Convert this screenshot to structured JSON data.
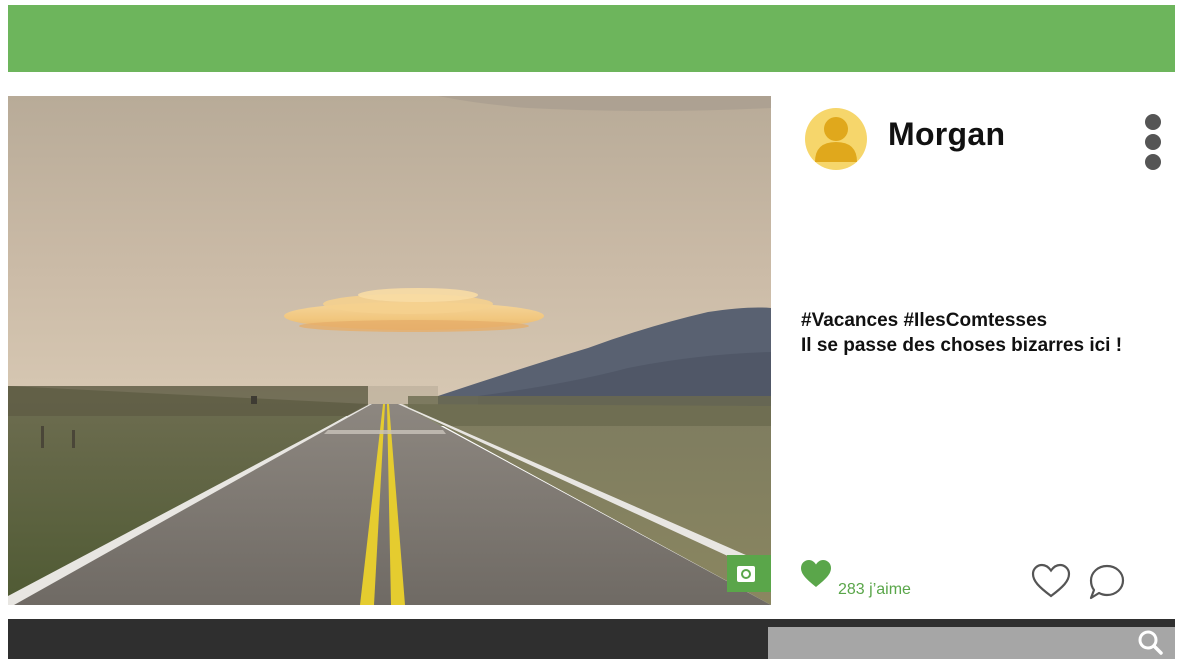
{
  "colors": {
    "accent": "#6db55c",
    "accent_dark": "#5aa64a",
    "footer": "#2f2f2f",
    "search_bg": "#a6a6a6",
    "avatar_bg": "#f6d66b",
    "avatar_figure": "#e0a81c",
    "icon_grey": "#555555"
  },
  "post": {
    "author": "Morgan",
    "caption_line1": "#Vacances #IlesComtesses",
    "caption_line2": "Il se passe des choses bizarres ici !",
    "likes_label": "283 j’aime",
    "photo_badge_icon": "camera-icon"
  },
  "icons": {
    "avatar": "user-avatar-icon",
    "more": "more-vertical-icon",
    "liked": "heart-filled-icon",
    "like": "heart-outline-icon",
    "comment": "comment-bubble-icon",
    "search": "search-icon"
  },
  "search": {
    "value": "",
    "placeholder": ""
  }
}
